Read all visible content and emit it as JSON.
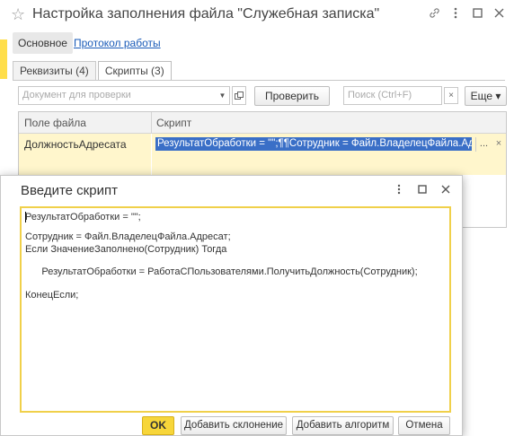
{
  "window": {
    "title": "Настройка заполнения файла \"Служебная записка\"",
    "star_icon": "star-icon",
    "link_icon": "link-icon",
    "menu_icon": "more-vertical-icon",
    "maximize_icon": "maximize-icon",
    "close_icon": "close-icon"
  },
  "nav": {
    "main_label": "Основное",
    "protocol_label": "Протокол работы"
  },
  "tabs": [
    {
      "label": "Реквизиты (4)",
      "active": false
    },
    {
      "label": "Скрипты (3)",
      "active": true
    }
  ],
  "toolbar": {
    "document_placeholder": "Документ для проверки",
    "check_label": "Проверить",
    "search_placeholder": "Поиск (Ctrl+F)",
    "search_clear": "×",
    "more_label": "Еще ▾"
  },
  "grid": {
    "columns": [
      "Поле файла",
      "Скрипт"
    ],
    "rows": [
      {
        "field": "ДолжностьАдресата",
        "script": "РезультатОбработки = \"\";¶¶Сотрудник = Файл.ВладелецФайла.Адресат;¶Е"
      }
    ],
    "cell_button": "...",
    "cell_clear": "×"
  },
  "dialog": {
    "title": "Введите скрипт",
    "code_lines": [
      "РезультатОбработки = \"\";",
      "",
      "Сотрудник = Файл.ВладелецФайла.Адресат;",
      "Если ЗначениеЗаполнено(Сотрудник) Тогда",
      "",
      "      РезультатОбработки = РаботаСПользователями.ПолучитьДолжность(Сотрудник);",
      "",
      "КонецЕсли;"
    ],
    "ok_label": "OK",
    "add_declension_label": "Добавить склонение",
    "add_algorithm_label": "Добавить алгоритм",
    "cancel_label": "Отмена"
  },
  "colors": {
    "accent_yellow": "#f7d63a",
    "selection_blue": "#3a6fc7",
    "link_blue": "#1a5bb8",
    "row_highlight": "#fff6cc"
  }
}
